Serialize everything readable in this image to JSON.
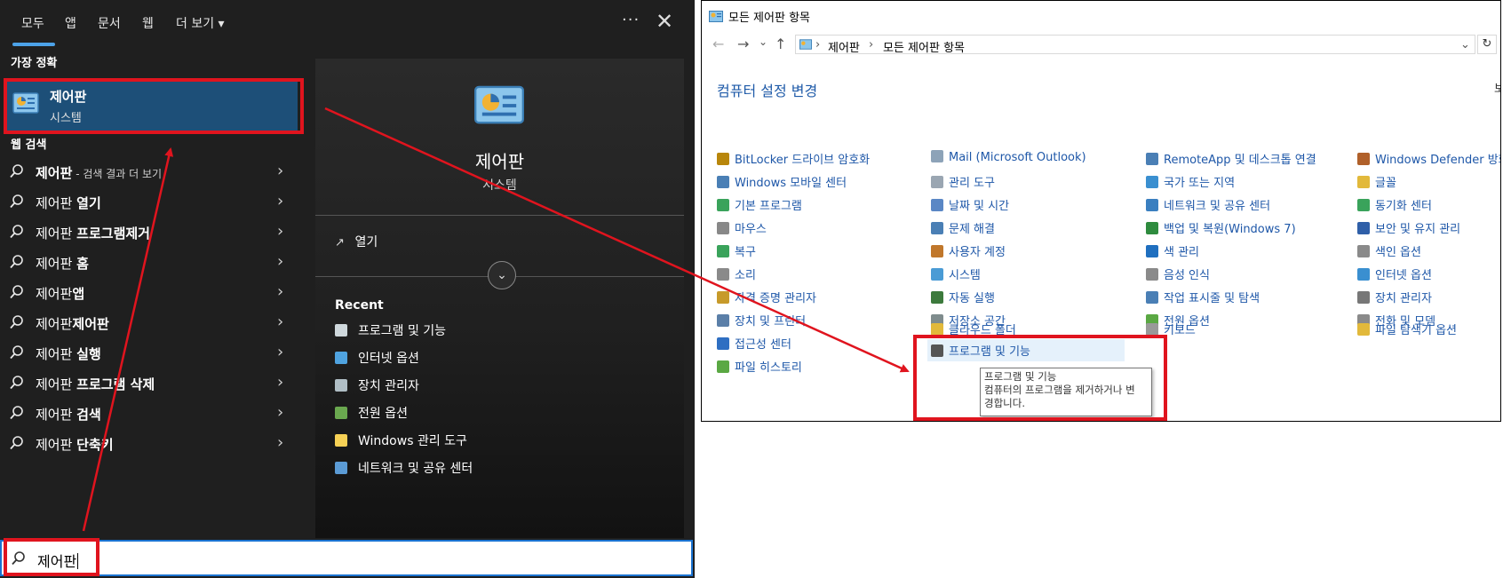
{
  "search_panel": {
    "tabs": [
      "모두",
      "앱",
      "문서",
      "웹",
      "더 보기 ▾"
    ],
    "more_glyph": "···",
    "close_glyph": "✕",
    "best_match_heading": "가장 정확",
    "best_match": {
      "title": "제어판",
      "subtitle": "시스템"
    },
    "web_heading": "웹 검색",
    "web_items": [
      {
        "bold": "제어판",
        "rest": "",
        "suffix": " - 검색 결과 더 보기"
      },
      {
        "bold": "제어판 ",
        "rest": "열기",
        "suffix": ""
      },
      {
        "bold": "제어판 ",
        "rest": "프로그램제거",
        "suffix": ""
      },
      {
        "bold": "제어판 ",
        "rest": "홈",
        "suffix": ""
      },
      {
        "bold": "제어판",
        "rest": "앱",
        "suffix": ""
      },
      {
        "bold": "제어판",
        "rest": "제어판",
        "suffix": ""
      },
      {
        "bold": "제어판 ",
        "rest": "실행",
        "suffix": ""
      },
      {
        "bold": "제어판 ",
        "rest": "프로그램 삭제",
        "suffix": ""
      },
      {
        "bold": "제어판 ",
        "rest": "검색",
        "suffix": ""
      },
      {
        "bold": "제어판 ",
        "rest": "단축키",
        "suffix": ""
      }
    ],
    "chevron_glyph": "›",
    "preview": {
      "title": "제어판",
      "subtitle": "시스템",
      "open_label": "열기",
      "open_icon_glyph": "↗",
      "expand_glyph": "⌄",
      "recent_heading": "Recent",
      "recent_items": [
        {
          "label": "프로그램 및 기능",
          "icon": "programs-icon",
          "color": "#cfd8dc"
        },
        {
          "label": "인터넷 옵션",
          "icon": "internet-options-icon",
          "color": "#4fa3e0"
        },
        {
          "label": "장치 관리자",
          "icon": "device-manager-icon",
          "color": "#b0bec5"
        },
        {
          "label": "전원 옵션",
          "icon": "power-options-icon",
          "color": "#6aa84f"
        },
        {
          "label": "Windows 관리 도구",
          "icon": "folder-icon",
          "color": "#f6d155"
        },
        {
          "label": "네트워크 및 공유 센터",
          "icon": "network-icon",
          "color": "#5b9bd5"
        }
      ]
    },
    "search_query": "제어판"
  },
  "control_panel": {
    "title": "모든 제어판 항목",
    "nav": {
      "back": "←",
      "forward": "→",
      "recent": "⌄",
      "up": "↑"
    },
    "address": [
      "제어판",
      "›",
      "모든 제어판 항목"
    ],
    "address_dropdown": "⌄",
    "refresh_glyph": "↻",
    "heading": "컴퓨터 설정 변경",
    "view_by": "보",
    "columns": [
      [
        {
          "label": "BitLocker 드라이브 암호화",
          "color": "#b8860b"
        },
        {
          "label": "Windows 모바일 센터",
          "color": "#4a7fb5"
        },
        {
          "label": "기본 프로그램",
          "color": "#3aa35b"
        },
        {
          "label": "마우스",
          "color": "#888888"
        },
        {
          "label": "복구",
          "color": "#3aa35b"
        },
        {
          "label": "소리",
          "color": "#8a8a8a"
        },
        {
          "label": "자격 증명 관리자",
          "color": "#c79a2a"
        },
        {
          "label": "장치 및 프린터",
          "color": "#5b7fa8"
        },
        {
          "label": "접근성 센터",
          "color": "#2f6fc2"
        },
        {
          "label": "파일 히스토리",
          "color": "#5aa843"
        }
      ],
      [
        {
          "label": "Mail (Microsoft Outlook)",
          "color": "#8da3b8"
        },
        {
          "label": "관리 도구",
          "color": "#9aa6b2"
        },
        {
          "label": "날짜 및 시간",
          "color": "#5a87c5"
        },
        {
          "label": "문제 해결",
          "color": "#4a7fb5"
        },
        {
          "label": "사용자 계정",
          "color": "#c0772b"
        },
        {
          "label": "시스템",
          "color": "#4a9bd5"
        },
        {
          "label": "자동 실행",
          "color": "#3c7a3c"
        },
        {
          "label": "저장소 공간",
          "color": "#7f8c8d"
        },
        {
          "label": "클라우드 폴더",
          "color": "#e2b93b"
        },
        {
          "label": "프로그램 및 기능",
          "color": "#555555"
        }
      ],
      [
        {
          "label": "RemoteApp 및 데스크톱 연결",
          "color": "#4a7fb5"
        },
        {
          "label": "국가 또는 지역",
          "color": "#3a8fd0"
        },
        {
          "label": "네트워크 및 공유 센터",
          "color": "#3a7fc0"
        },
        {
          "label": "백업 및 복원(Windows 7)",
          "color": "#2e8b3e"
        },
        {
          "label": "색 관리",
          "color": "#1f6fbf"
        },
        {
          "label": "음성 인식",
          "color": "#8a8a8a"
        },
        {
          "label": "작업 표시줄 및 탐색",
          "color": "#4a7fb5"
        },
        {
          "label": "전원 옵션",
          "color": "#5aa843"
        },
        {
          "label": "키보드",
          "color": "#999999"
        }
      ],
      [
        {
          "label": "Windows Defender 방화벽",
          "color": "#b0602a"
        },
        {
          "label": "글꼴",
          "color": "#e2b93b"
        },
        {
          "label": "동기화 센터",
          "color": "#3aa35b"
        },
        {
          "label": "보안 및 유지 관리",
          "color": "#2f5fa8"
        },
        {
          "label": "색인 옵션",
          "color": "#8a8a8a"
        },
        {
          "label": "인터넷 옵션",
          "color": "#3a8fd0"
        },
        {
          "label": "장치 관리자",
          "color": "#777777"
        },
        {
          "label": "전화 및 모뎀",
          "color": "#8a8a8a"
        },
        {
          "label": "파일 탐색기 옵션",
          "color": "#e2b93b"
        }
      ]
    ],
    "tooltip": [
      "프로그램 및 기능",
      "컴퓨터의 프로그램을 제거하거나 변",
      "경합니다."
    ]
  },
  "colors": {
    "accent": "#1d4f78",
    "link": "#1e57a8",
    "annotation": "#e0141e"
  }
}
